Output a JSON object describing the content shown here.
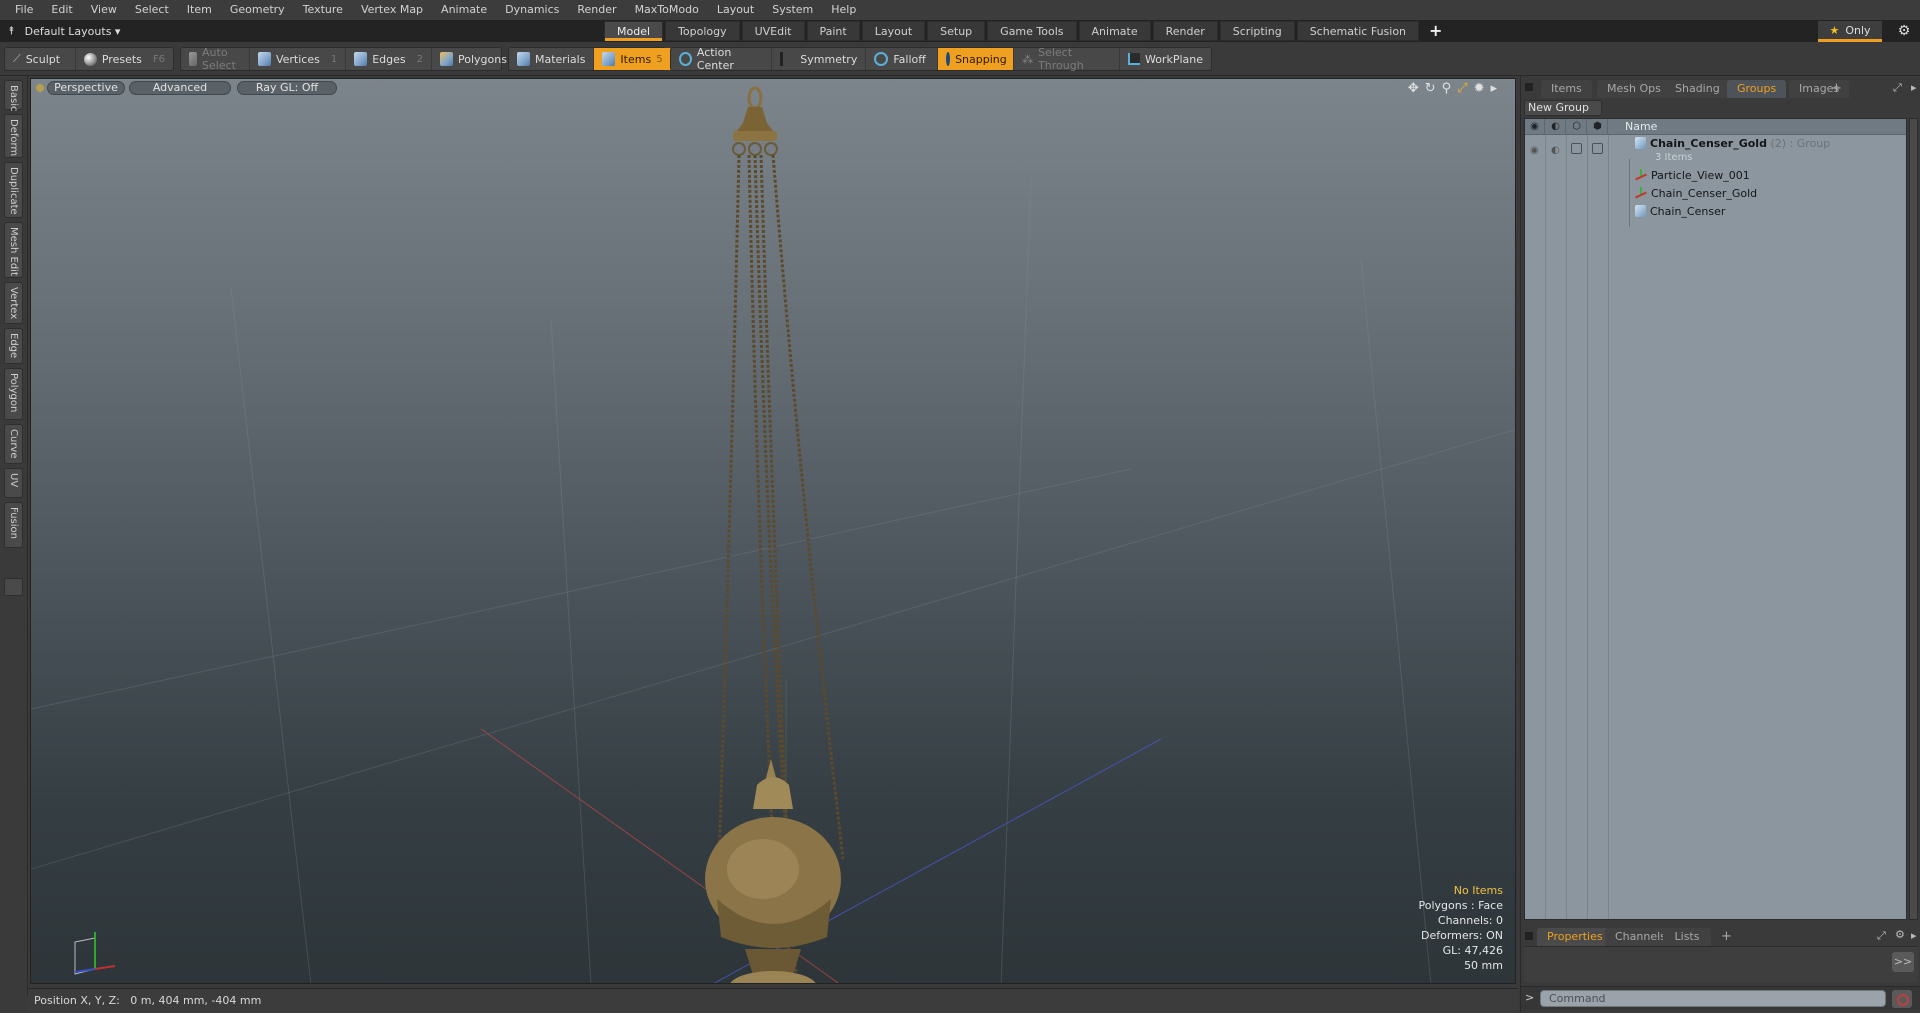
{
  "menu": [
    "File",
    "Edit",
    "View",
    "Select",
    "Item",
    "Geometry",
    "Texture",
    "Vertex Map",
    "Animate",
    "Dynamics",
    "Render",
    "MaxToModo",
    "Layout",
    "System",
    "Help"
  ],
  "layouts": {
    "label": "Default Layouts ▾"
  },
  "tabs": [
    {
      "label": "Model",
      "active": true
    },
    {
      "label": "Topology"
    },
    {
      "label": "UVEdit"
    },
    {
      "label": "Paint"
    },
    {
      "label": "Layout"
    },
    {
      "label": "Setup"
    },
    {
      "label": "Game Tools"
    },
    {
      "label": "Animate"
    },
    {
      "label": "Render"
    },
    {
      "label": "Scripting"
    },
    {
      "label": "Schematic Fusion"
    }
  ],
  "tab_add": "+",
  "only_button": "Only",
  "toolbar": {
    "sculpt": "Sculpt",
    "presets": "Presets",
    "presets_key": "F6",
    "auto_select": "Auto Select",
    "vertices": "Vertices",
    "vertices_key": "1",
    "edges": "Edges",
    "edges_key": "2",
    "polygons": "Polygons",
    "materials": "Materials",
    "items": "Items",
    "items_key": "5",
    "action_center": "Action Center",
    "symmetry": "Symmetry",
    "falloff": "Falloff",
    "snapping": "Snapping",
    "select_through": "Select Through",
    "workplane": "WorkPlane"
  },
  "left_tabs": [
    "Basic",
    "Deform",
    "Duplicate",
    "Mesh Edit",
    "Vertex",
    "Edge",
    "Polygon",
    "Curve",
    "UV",
    "Fusion"
  ],
  "viewport": {
    "view_mode": "Perspective",
    "advanced": "Advanced",
    "raygl": "Ray GL: Off",
    "info": {
      "selection": "No Items",
      "polygons": "Polygons : Face",
      "channels": "Channels: 0",
      "deformers": "Deformers: ON",
      "gl": "GL: 47,426",
      "scale": "50 mm"
    }
  },
  "status": {
    "position": "Position X, Y, Z:   0 m, 404 mm, -404 mm"
  },
  "right_panel": {
    "tabs": [
      {
        "label": "Items"
      },
      {
        "label": "Mesh Ops"
      },
      {
        "label": "Shading"
      },
      {
        "label": "Groups",
        "active": true
      },
      {
        "label": "Images"
      }
    ],
    "tab_add": "+",
    "new_group": "New Group",
    "column_name": "Name",
    "group": {
      "name": "Chain_Censer_Gold",
      "count": "(2)",
      "type": ": Group",
      "items_label": "3 Items",
      "children": [
        "Particle_View_001",
        "Chain_Censer_Gold",
        "Chain_Censer"
      ]
    },
    "bottom_tabs": [
      {
        "label": "Properties",
        "active": true
      },
      {
        "label": "Channels"
      },
      {
        "label": "Lists"
      }
    ],
    "bottom_tab_add": "+",
    "more_button": ">>",
    "command_prompt": ">",
    "command_placeholder": "Command"
  },
  "colors": {
    "accent": "#f0a020",
    "active_tab_text": "#f0a020",
    "info_highlight": "#f0c040"
  }
}
